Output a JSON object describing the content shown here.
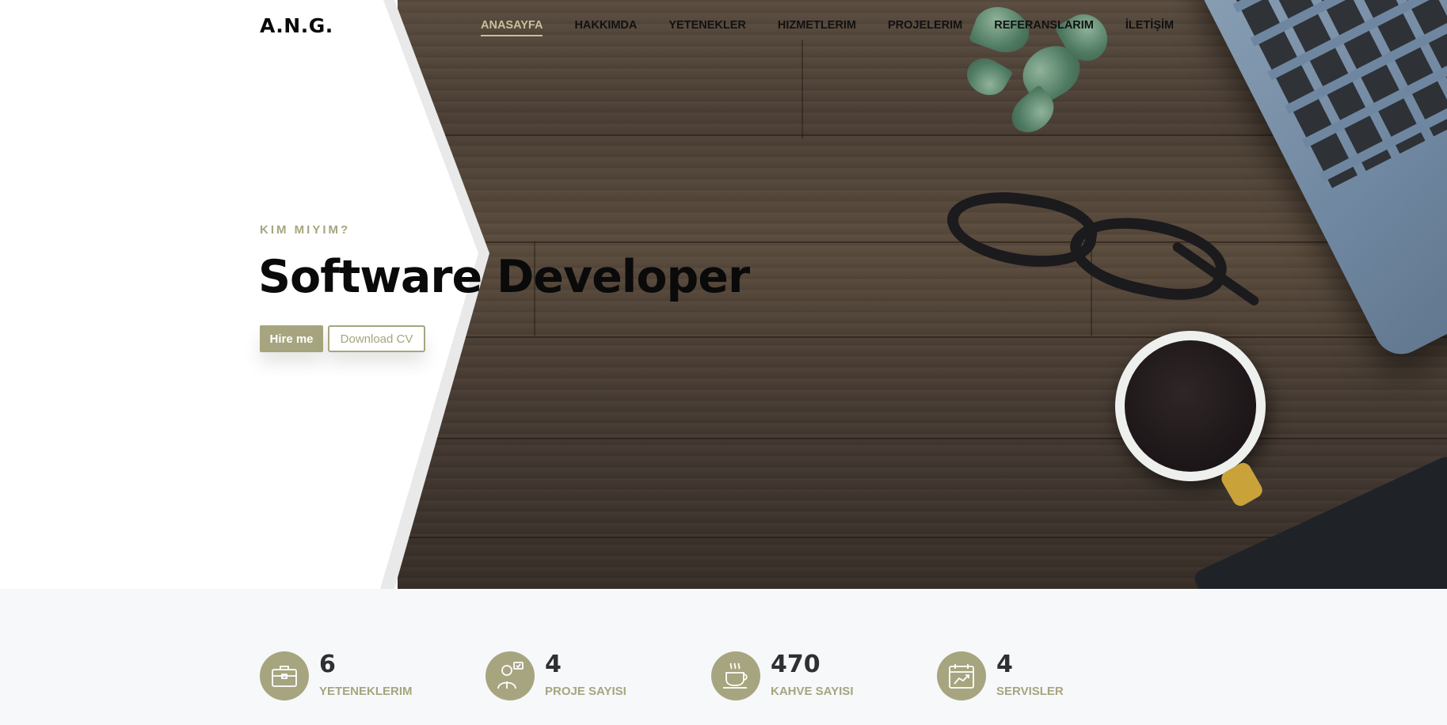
{
  "brand": {
    "logo": "A.N.G."
  },
  "nav": {
    "items": [
      {
        "label": "ANASAYFA",
        "active": true
      },
      {
        "label": "HAKKIMDA",
        "active": false
      },
      {
        "label": "YETENEKLER",
        "active": false
      },
      {
        "label": "HIZMETLERIM",
        "active": false
      },
      {
        "label": "PROJELERIM",
        "active": false
      },
      {
        "label": "REFERANSLARIM",
        "active": false
      },
      {
        "label": "İLETİŞİM",
        "active": false
      }
    ]
  },
  "hero": {
    "kicker": "KIM MIYIM?",
    "title": "Software Developer",
    "hire_label": "Hire me",
    "cv_label": "Download CV"
  },
  "stats": [
    {
      "icon": "briefcase-icon",
      "value": "6",
      "label": "YETENEKLERIM"
    },
    {
      "icon": "developer-icon",
      "value": "4",
      "label": "PROJE SAYISI"
    },
    {
      "icon": "coffee-cup-icon",
      "value": "470",
      "label": "KAHVE SAYISI"
    },
    {
      "icon": "calendar-chart-icon",
      "value": "4",
      "label": "SERVISLER"
    }
  ],
  "colors": {
    "accent": "#a6a57f",
    "active_nav": "#c7c09a",
    "text_dark": "#0a0a0a",
    "stats_bg": "#f7f8fa"
  }
}
